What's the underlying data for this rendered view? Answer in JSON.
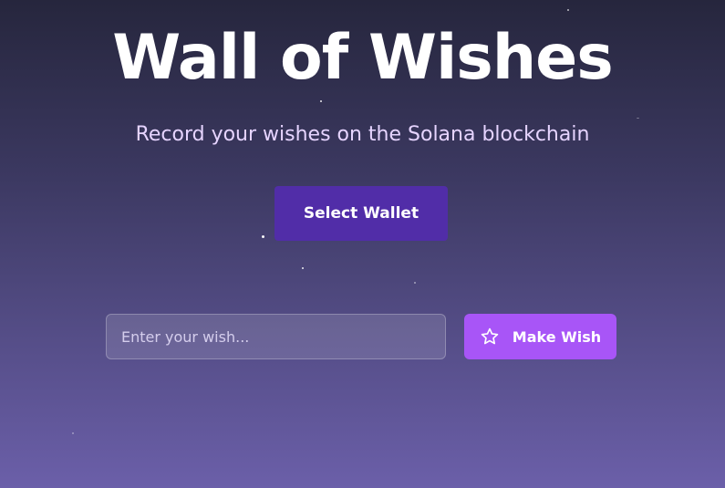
{
  "header": {
    "title": "Wall of Wishes",
    "subtitle": "Record your wishes on the Solana blockchain"
  },
  "wallet": {
    "button_label": "Select Wallet"
  },
  "wish_form": {
    "input_placeholder": "Enter your wish...",
    "input_value": "",
    "submit_label": "Make Wish",
    "submit_icon": "star-icon"
  },
  "colors": {
    "background_top": "#26263d",
    "background_bottom": "#6b5fa9",
    "wallet_button": "#512da8",
    "make_wish_button": "#a855f7",
    "subtitle_text": "#e6d4ff"
  }
}
